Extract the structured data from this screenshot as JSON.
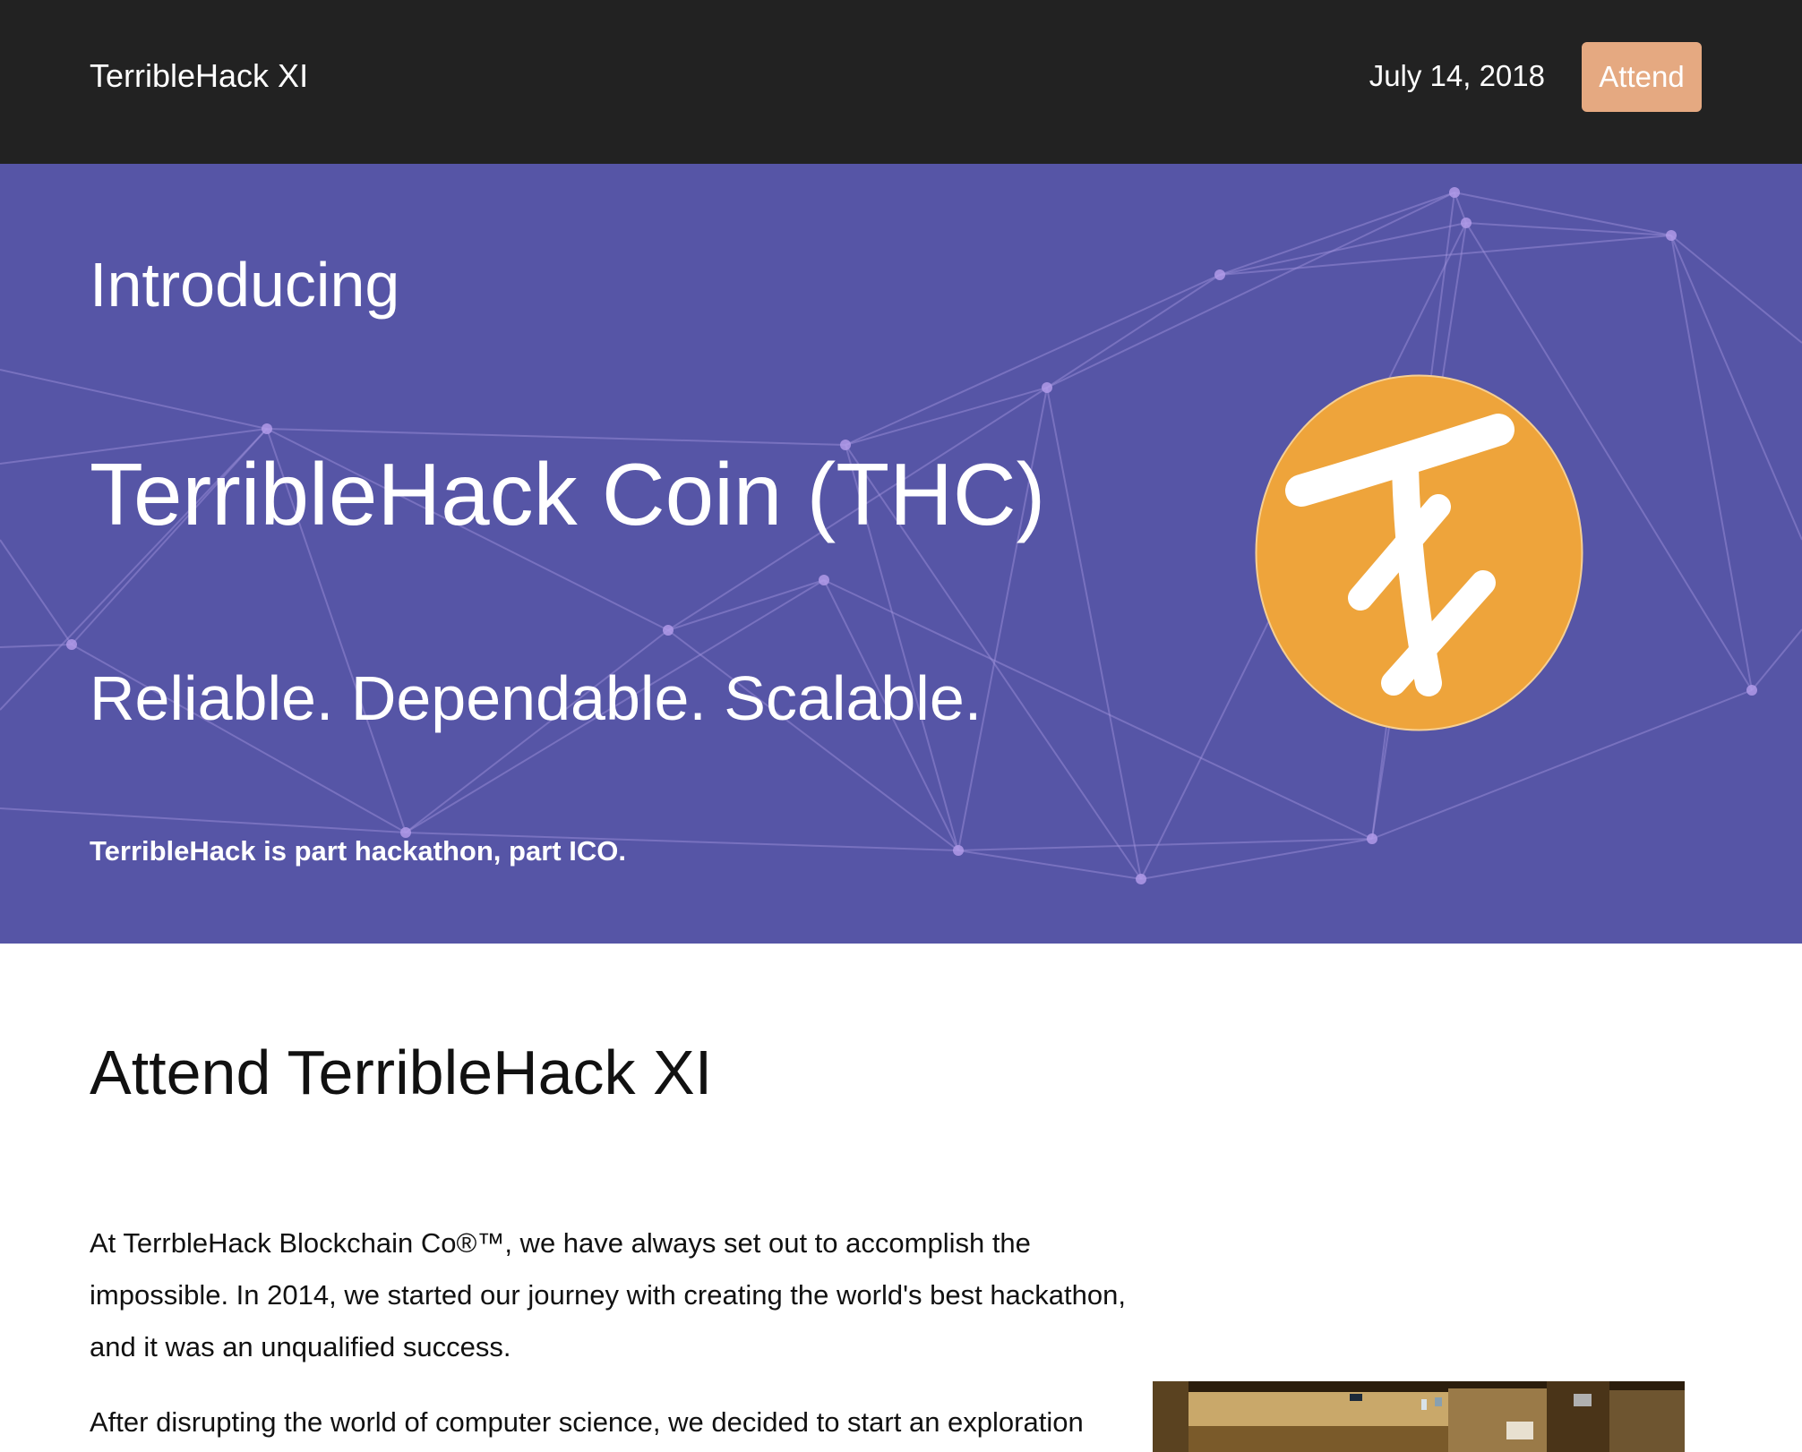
{
  "nav": {
    "brand": "TerribleHack XI",
    "date": "July 14, 2018",
    "attend_label": "Attend"
  },
  "hero": {
    "intro": "Introducing",
    "title": "TerribleHack Coin (THC)",
    "tagline": "Reliable. Dependable. Scalable.",
    "subtitle": "TerribleHack is part hackathon, part ICO."
  },
  "content": {
    "section_title": "Attend TerribleHack XI",
    "paragraph_1": "At TerrbleHack Blockchain Co®™, we have always set out to accomplish the impossible. In 2014, we started our journey with creating the world's best hackathon, and it was an unqualified success.",
    "paragraph_2": "After disrupting the world of computer science, we decided to start an exploration"
  },
  "colors": {
    "navbar_bg": "#222222",
    "hero_bg": "#5655a6",
    "attend_button": "#e5a981",
    "coin": "#eea43b",
    "network_lines": "#9b8ed6"
  },
  "icons": {
    "coin_logo": "thc-coin-icon"
  }
}
